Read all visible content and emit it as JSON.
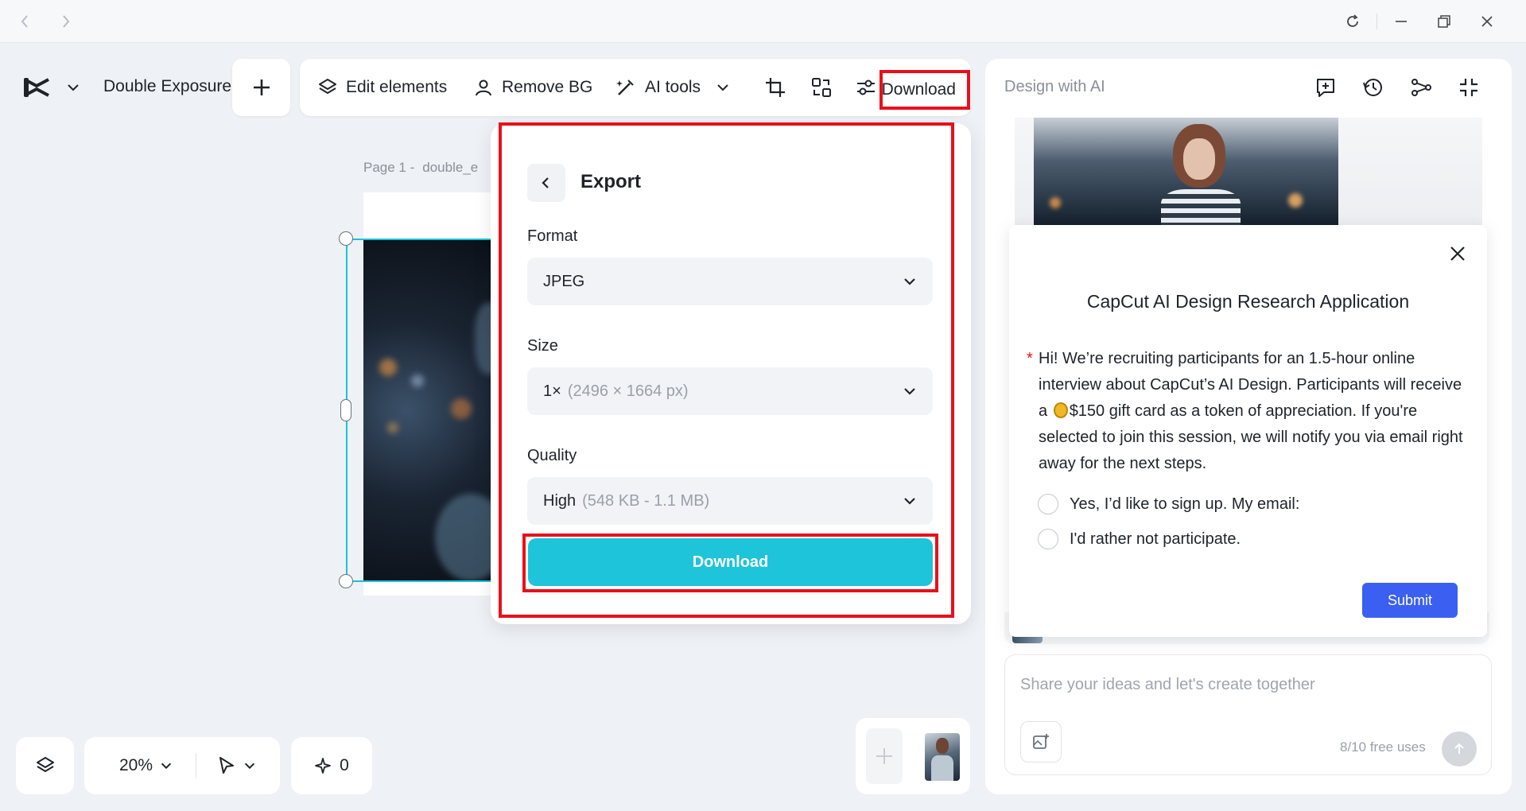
{
  "titlebar": {
    "back_icon": "chevron-left-icon",
    "forward_icon": "chevron-right-icon",
    "refresh_icon": "refresh-icon",
    "minimize_icon": "minimize-icon",
    "restore_icon": "restore-icon",
    "close_icon": "close-icon"
  },
  "header": {
    "doc_title": "Double Exposure",
    "add_icon": "plus-icon"
  },
  "toolbar": {
    "edit_elements": "Edit elements",
    "remove_bg": "Remove BG",
    "ai_tools": "AI tools",
    "download_label": "Download"
  },
  "canvas": {
    "page_label": "Page 1 -",
    "file_name": "double_e"
  },
  "export": {
    "title": "Export",
    "format_label": "Format",
    "format_value": "JPEG",
    "size_label": "Size",
    "size_value": "1×",
    "size_detail": "(2496 × 1664 px)",
    "quality_label": "Quality",
    "quality_value": "High",
    "quality_detail": "(548 KB - 1.1 MB)",
    "download_button": "Download"
  },
  "ai_panel": {
    "title": "Design with AI",
    "chat_placeholder": "Share your ideas and let's create together",
    "free_uses": "8/10 free uses"
  },
  "survey": {
    "title": "CapCut AI Design Research Application",
    "text_part1": "Hi! We’re recruiting participants for an 1.5-hour online interview about CapCut’s AI Design. Participants will receive a ",
    "text_part2": "$150 gift card as a token of appreciation. If you're selected to join this session, we will notify you via email right away for the next steps.",
    "option_yes": "Yes, I’d like to sign up. My email:",
    "option_no": "I'd rather not participate.",
    "submit": "Submit"
  },
  "bottom": {
    "zoom": "20%",
    "points": "0"
  },
  "colors": {
    "accent": "#1ec4d9",
    "submit": "#3b5ff0",
    "highlight": "#e8101a"
  }
}
